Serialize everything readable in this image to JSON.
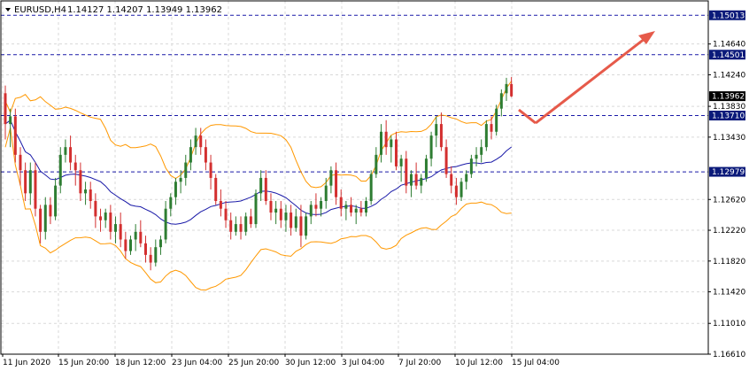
{
  "header": {
    "symbol": "EURUSD,H4",
    "ohlc": "1.14127 1.14207 1.13949 1.13962"
  },
  "colors": {
    "bull": "#2e7d32",
    "bear": "#d32f2f",
    "band": "#ff9800",
    "ma": "#1a1aa8",
    "level": "#1a1aa8",
    "grid": "#d9d9d9",
    "arrow": "#e65a4a",
    "tag_bg": "#0b1a7a",
    "price_tag_bg": "#000000"
  },
  "chart_data": {
    "type": "candlestick",
    "y_ticks": [
      "1.16610",
      "1.11010",
      "1.11420",
      "1.11820",
      "1.12220",
      "1.12620",
      "1.13430",
      "1.13830",
      "1.14240",
      "1.14640"
    ],
    "y_tick_values": [
      1.1061,
      1.1101,
      1.1142,
      1.1182,
      1.1222,
      1.1262,
      1.1343,
      1.1383,
      1.1424,
      1.1464
    ],
    "ylim": [
      1.1061,
      1.152
    ],
    "x_labels": [
      "11 Jun 2020",
      "15 Jun 20:00",
      "18 Jun 12:00",
      "23 Jun 04:00",
      "25 Jun 20:00",
      "30 Jun 12:00",
      "3 Jul 04:00",
      "7 Jul 20:00",
      "10 Jul 12:00",
      "15 Jul 04:00"
    ],
    "levels": [
      {
        "label": "1.15013",
        "value": 1.15013
      },
      {
        "label": "1.14501",
        "value": 1.14501
      },
      {
        "label": "1.13710",
        "value": 1.1371
      },
      {
        "label": "1.12979",
        "value": 1.12979
      }
    ],
    "current_price": {
      "label": "1.13962",
      "value": 1.13962
    },
    "candles": [
      [
        1.14,
        1.141,
        1.134,
        1.136
      ],
      [
        1.136,
        1.138,
        1.133,
        1.137
      ],
      [
        1.137,
        1.138,
        1.131,
        1.132
      ],
      [
        1.132,
        1.133,
        1.128,
        1.13
      ],
      [
        1.13,
        1.131,
        1.126,
        1.127
      ],
      [
        1.127,
        1.131,
        1.1255,
        1.13
      ],
      [
        1.13,
        1.131,
        1.124,
        1.125
      ],
      [
        1.125,
        1.1255,
        1.1205,
        1.122
      ],
      [
        1.122,
        1.1265,
        1.121,
        1.1255
      ],
      [
        1.1255,
        1.1265,
        1.123,
        1.124
      ],
      [
        1.124,
        1.129,
        1.1235,
        1.128
      ],
      [
        1.128,
        1.133,
        1.127,
        1.132
      ],
      [
        1.132,
        1.134,
        1.131,
        1.133
      ],
      [
        1.133,
        1.1345,
        1.13,
        1.131
      ],
      [
        1.131,
        1.132,
        1.128,
        1.13
      ],
      [
        1.13,
        1.131,
        1.126,
        1.127
      ],
      [
        1.127,
        1.1285,
        1.1255,
        1.1275
      ],
      [
        1.1275,
        1.1285,
        1.125,
        1.126
      ],
      [
        1.126,
        1.127,
        1.1225,
        1.124
      ],
      [
        1.124,
        1.125,
        1.122,
        1.1235
      ],
      [
        1.1235,
        1.125,
        1.1225,
        1.1245
      ],
      [
        1.1245,
        1.1255,
        1.121,
        1.122
      ],
      [
        1.122,
        1.124,
        1.1205,
        1.123
      ],
      [
        1.123,
        1.1245,
        1.12,
        1.121
      ],
      [
        1.121,
        1.122,
        1.1185,
        1.1195
      ],
      [
        1.1195,
        1.1215,
        1.119,
        1.121
      ],
      [
        1.121,
        1.123,
        1.1195,
        1.122
      ],
      [
        1.122,
        1.1235,
        1.12,
        1.1205
      ],
      [
        1.1205,
        1.1215,
        1.118,
        1.119
      ],
      [
        1.119,
        1.12,
        1.117,
        1.118
      ],
      [
        1.118,
        1.121,
        1.1175,
        1.12
      ],
      [
        1.12,
        1.1215,
        1.119,
        1.121
      ],
      [
        1.121,
        1.126,
        1.1205,
        1.125
      ],
      [
        1.125,
        1.127,
        1.124,
        1.1265
      ],
      [
        1.1265,
        1.129,
        1.1255,
        1.1285
      ],
      [
        1.1285,
        1.13,
        1.127,
        1.129
      ],
      [
        1.129,
        1.132,
        1.128,
        1.131
      ],
      [
        1.131,
        1.134,
        1.13,
        1.133
      ],
      [
        1.133,
        1.1355,
        1.132,
        1.1345
      ],
      [
        1.1345,
        1.1355,
        1.132,
        1.133
      ],
      [
        1.133,
        1.134,
        1.13,
        1.131
      ],
      [
        1.131,
        1.132,
        1.1275,
        1.129
      ],
      [
        1.129,
        1.1295,
        1.1255,
        1.126
      ],
      [
        1.126,
        1.1275,
        1.124,
        1.125
      ],
      [
        1.125,
        1.126,
        1.1225,
        1.1235
      ],
      [
        1.1235,
        1.1245,
        1.121,
        1.122
      ],
      [
        1.122,
        1.124,
        1.1215,
        1.123
      ],
      [
        1.123,
        1.124,
        1.121,
        1.122
      ],
      [
        1.122,
        1.1245,
        1.1215,
        1.124
      ],
      [
        1.124,
        1.125,
        1.1225,
        1.123
      ],
      [
        1.123,
        1.1275,
        1.1225,
        1.127
      ],
      [
        1.127,
        1.13,
        1.126,
        1.129
      ],
      [
        1.129,
        1.13,
        1.1255,
        1.126
      ],
      [
        1.126,
        1.127,
        1.1235,
        1.1245
      ],
      [
        1.1245,
        1.126,
        1.123,
        1.125
      ],
      [
        1.125,
        1.126,
        1.1225,
        1.1235
      ],
      [
        1.1235,
        1.1255,
        1.122,
        1.1245
      ],
      [
        1.1245,
        1.1255,
        1.1215,
        1.1225
      ],
      [
        1.1225,
        1.125,
        1.122,
        1.124
      ],
      [
        1.124,
        1.1255,
        1.12,
        1.1215
      ],
      [
        1.1215,
        1.1245,
        1.121,
        1.124
      ],
      [
        1.124,
        1.126,
        1.123,
        1.1255
      ],
      [
        1.1255,
        1.127,
        1.124,
        1.125
      ],
      [
        1.125,
        1.1265,
        1.124,
        1.126
      ],
      [
        1.126,
        1.129,
        1.125,
        1.128
      ],
      [
        1.128,
        1.1305,
        1.127,
        1.13
      ],
      [
        1.13,
        1.131,
        1.1255,
        1.1265
      ],
      [
        1.1265,
        1.1275,
        1.124,
        1.125
      ],
      [
        1.125,
        1.126,
        1.1235,
        1.1255
      ],
      [
        1.1255,
        1.1265,
        1.124,
        1.1245
      ],
      [
        1.1245,
        1.1255,
        1.123,
        1.125
      ],
      [
        1.125,
        1.126,
        1.124,
        1.1245
      ],
      [
        1.1245,
        1.1265,
        1.124,
        1.126
      ],
      [
        1.126,
        1.13,
        1.1255,
        1.1295
      ],
      [
        1.1295,
        1.133,
        1.129,
        1.132
      ],
      [
        1.132,
        1.136,
        1.131,
        1.135
      ],
      [
        1.135,
        1.1365,
        1.132,
        1.133
      ],
      [
        1.133,
        1.1345,
        1.131,
        1.134
      ],
      [
        1.134,
        1.135,
        1.13,
        1.1305
      ],
      [
        1.1305,
        1.132,
        1.1285,
        1.1315
      ],
      [
        1.1315,
        1.1325,
        1.127,
        1.128
      ],
      [
        1.128,
        1.13,
        1.1265,
        1.1295
      ],
      [
        1.1295,
        1.131,
        1.1275,
        1.128
      ],
      [
        1.128,
        1.1295,
        1.127,
        1.129
      ],
      [
        1.129,
        1.132,
        1.1285,
        1.1315
      ],
      [
        1.1315,
        1.135,
        1.1305,
        1.1345
      ],
      [
        1.1345,
        1.137,
        1.133,
        1.136
      ],
      [
        1.136,
        1.1375,
        1.1325,
        1.133
      ],
      [
        1.133,
        1.134,
        1.129,
        1.1295
      ],
      [
        1.1295,
        1.1305,
        1.127,
        1.128
      ],
      [
        1.128,
        1.129,
        1.1255,
        1.1265
      ],
      [
        1.1265,
        1.129,
        1.126,
        1.1285
      ],
      [
        1.1285,
        1.13,
        1.1275,
        1.1295
      ],
      [
        1.1295,
        1.132,
        1.129,
        1.1315
      ],
      [
        1.1315,
        1.133,
        1.1305,
        1.132
      ],
      [
        1.132,
        1.134,
        1.131,
        1.133
      ],
      [
        1.133,
        1.1365,
        1.1325,
        1.136
      ],
      [
        1.136,
        1.137,
        1.134,
        1.135
      ],
      [
        1.135,
        1.1385,
        1.1345,
        1.138
      ],
      [
        1.138,
        1.1405,
        1.137,
        1.14
      ],
      [
        1.14,
        1.142,
        1.139,
        1.1412
      ],
      [
        1.1412,
        1.1421,
        1.1395,
        1.1396
      ]
    ]
  }
}
